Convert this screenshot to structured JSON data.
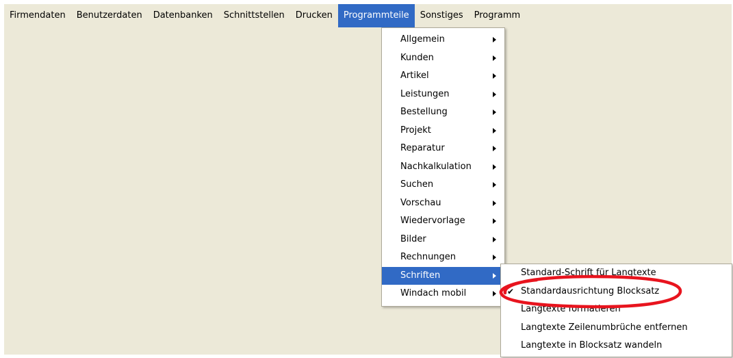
{
  "menubar": {
    "items": [
      {
        "label": "Firmendaten"
      },
      {
        "label": "Benutzerdaten"
      },
      {
        "label": "Datenbanken"
      },
      {
        "label": "Schnittstellen"
      },
      {
        "label": "Drucken"
      },
      {
        "label": "Programmteile"
      },
      {
        "label": "Sonstiges"
      },
      {
        "label": "Programm"
      }
    ],
    "active_item": "Programmteile"
  },
  "programmteile_menu": {
    "items": [
      {
        "label": "Allgemein"
      },
      {
        "label": "Kunden"
      },
      {
        "label": "Artikel"
      },
      {
        "label": "Leistungen"
      },
      {
        "label": "Bestellung"
      },
      {
        "label": "Projekt"
      },
      {
        "label": "Reparatur"
      },
      {
        "label": "Nachkalkulation"
      },
      {
        "label": "Suchen"
      },
      {
        "label": "Vorschau"
      },
      {
        "label": "Wiedervorlage"
      },
      {
        "label": "Bilder"
      },
      {
        "label": "Rechnungen"
      },
      {
        "label": "Schriften"
      },
      {
        "label": "Windach mobil"
      }
    ],
    "highlighted_item": "Schriften"
  },
  "schriften_menu": {
    "items": [
      {
        "label": "Standard-Schrift für Langtexte",
        "checked": false
      },
      {
        "label": "Standardausrichtung Blocksatz",
        "checked": true
      },
      {
        "label": "Langtexte formatieren",
        "checked": false
      },
      {
        "label": "Langtexte Zeilenumbrüche entfernen",
        "checked": false
      },
      {
        "label": "Langtexte in Blocksatz wandeln",
        "checked": false
      }
    ],
    "check_glyph": "✔"
  },
  "colors": {
    "background": "#ECE9D8",
    "menu_background": "#FFFFFF",
    "highlight": "#316AC5",
    "annotation_ellipse": "#E8141E"
  }
}
